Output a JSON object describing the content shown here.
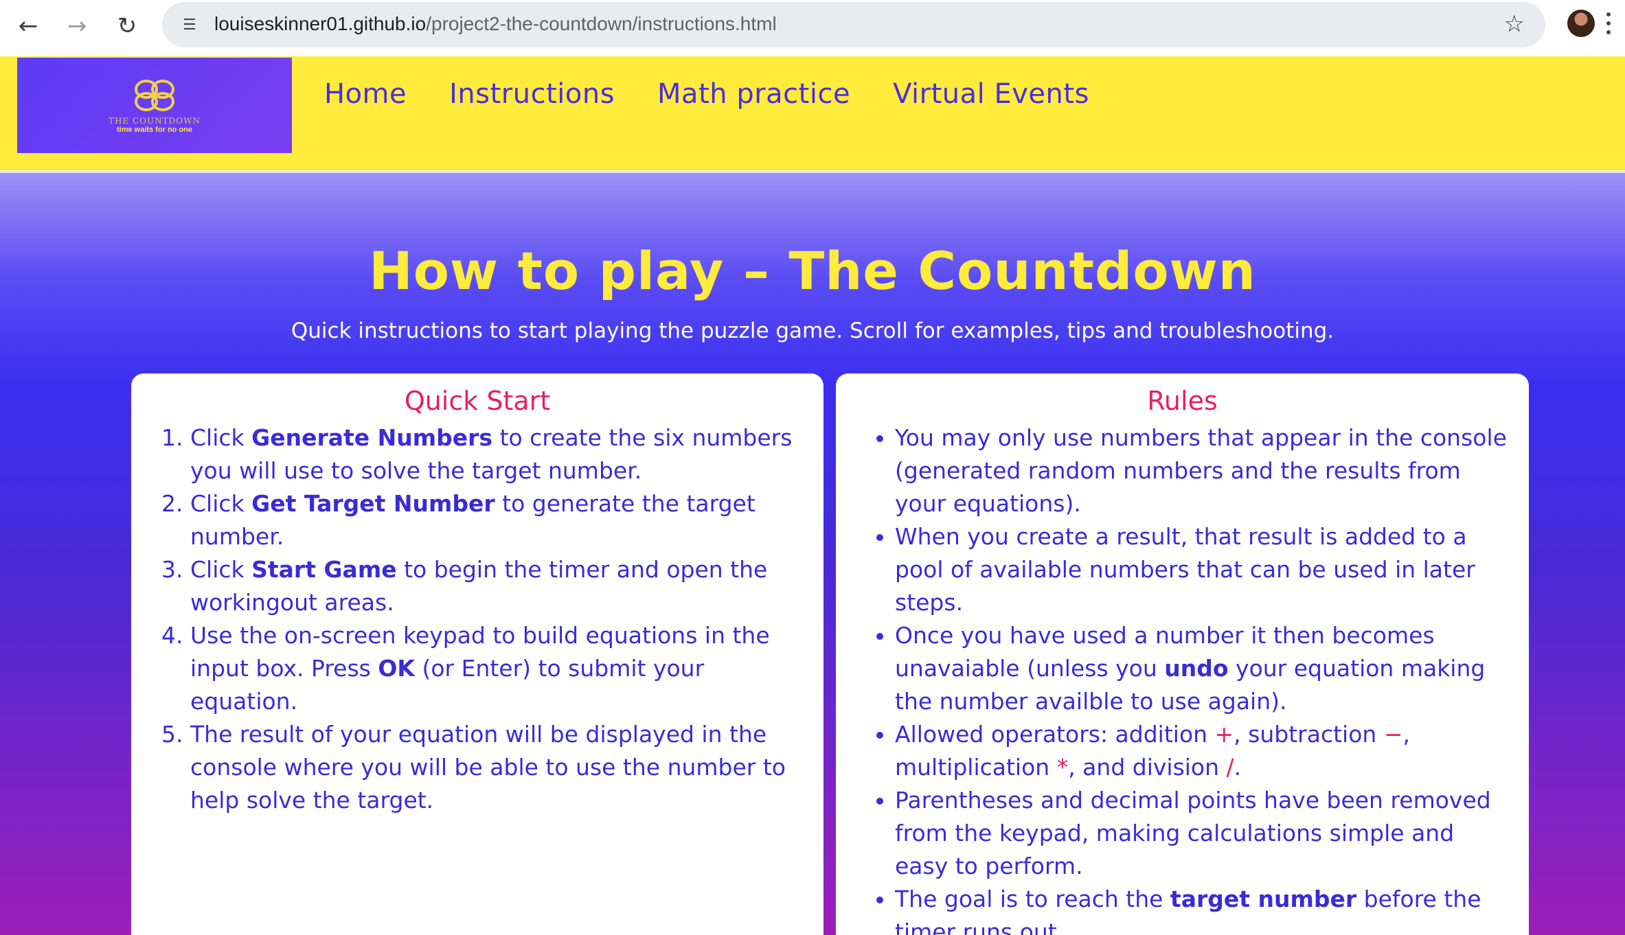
{
  "browser": {
    "url_host": "louiseskinner01.github.io",
    "url_path": "/project2-the-countdown/instructions.html",
    "back_icon": "arrow-left",
    "forward_icon": "arrow-right",
    "reload_icon": "reload",
    "site_info_icon": "tune",
    "bookmark_icon": "star"
  },
  "header": {
    "logo": {
      "title": "THE COUNTDOWN",
      "tagline": "time waits for no one"
    },
    "nav": [
      {
        "label": "Home"
      },
      {
        "label": "Instructions"
      },
      {
        "label": "Math practice"
      },
      {
        "label": "Virtual Events"
      }
    ]
  },
  "hero": {
    "title": "How to play – The Countdown",
    "subtitle": "Quick instructions to start playing the puzzle game. Scroll for examples, tips and troubleshooting."
  },
  "quick_start": {
    "heading": "Quick Start",
    "steps": [
      {
        "pre": "Click ",
        "bold": "Generate Numbers",
        "post": " to create the six numbers you will use to solve the target number."
      },
      {
        "pre": "Click ",
        "bold": "Get Target Number",
        "post": " to generate the target number."
      },
      {
        "pre": "Click ",
        "bold": "Start Game",
        "post": " to begin the timer and open the workingout areas."
      },
      {
        "pre": "Use the on-screen keypad to build equations in the input box. Press ",
        "bold": "OK",
        "post": " (or Enter) to submit your equation."
      },
      {
        "pre": "The result of your equation will be displayed in the console where you will be able to use the number to help solve the target.",
        "bold": "",
        "post": ""
      }
    ]
  },
  "rules": {
    "heading": "Rules",
    "items": [
      {
        "pre": "You may only use numbers that appear in the console (generated random numbers and the results from your equations).",
        "bold": "",
        "post": ""
      },
      {
        "pre": "When you create a result, that result is added to a pool of available numbers that can be used in later steps.",
        "bold": "",
        "post": ""
      },
      {
        "pre": "Once you have used a number it then becomes unavaiable (unless you ",
        "bold": "undo",
        "post": " your equation making the number availble to use again)."
      },
      {
        "pre": "Allowed operators: addition ",
        "op1": "+",
        "mid1": ", subtraction ",
        "op2": "−",
        "mid2": ", multiplication ",
        "op3": "*",
        "mid3": ", and division ",
        "op4": "/",
        "end": "."
      },
      {
        "pre": "Parentheses and decimal points have been removed from the keypad, making calculations simple and easy to perform.",
        "bold": "",
        "post": ""
      },
      {
        "pre": "The goal is to reach the ",
        "bold": "target number",
        "post": " before the timer runs out."
      }
    ]
  },
  "colors": {
    "header_bg": "#ffeb3b",
    "nav_text": "#4a2ee0",
    "title": "#ffeb3b",
    "card_heading": "#e91e63",
    "card_text": "#3a2bd8"
  }
}
